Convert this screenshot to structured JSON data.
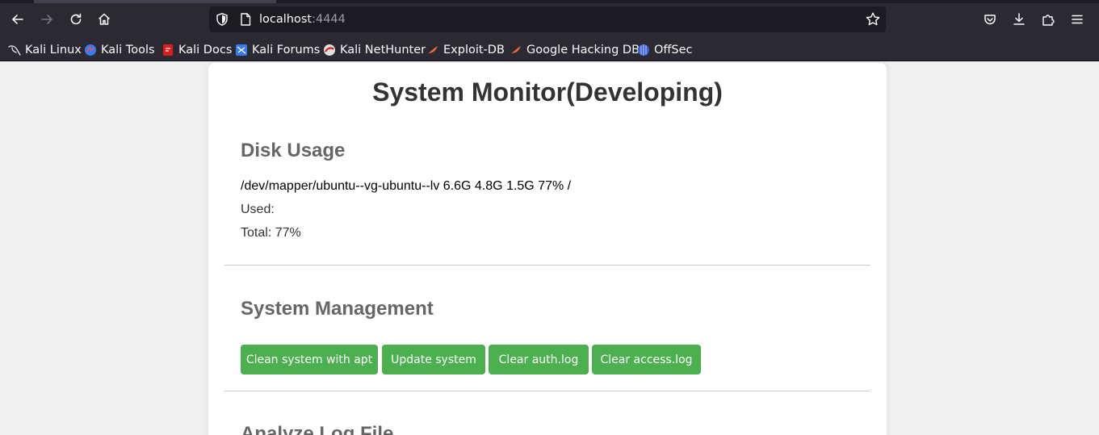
{
  "browser": {
    "url_host": "localhost",
    "url_port": ":4444",
    "bookmarks": [
      {
        "label": "Kali Linux",
        "icon": "kali-dragon-icon"
      },
      {
        "label": "Kali Tools",
        "icon": "kali-tools-icon"
      },
      {
        "label": "Kali Docs",
        "icon": "kali-docs-icon"
      },
      {
        "label": "Kali Forums",
        "icon": "kali-forums-icon"
      },
      {
        "label": "Kali NetHunter",
        "icon": "nethunter-icon"
      },
      {
        "label": "Exploit-DB",
        "icon": "exploit-db-icon"
      },
      {
        "label": "Google Hacking DB",
        "icon": "ghdb-icon"
      },
      {
        "label": "OffSec",
        "icon": "offsec-icon"
      }
    ]
  },
  "page": {
    "title": "System Monitor(Developing)",
    "disk": {
      "heading": "Disk Usage",
      "df_line": "/dev/mapper/ubuntu--vg-ubuntu--lv 6.6G 4.8G 1.5G 77% /",
      "used": "Used:",
      "total": "Total: 77%"
    },
    "management": {
      "heading": "System Management",
      "buttons": [
        "Clean system with apt",
        "Update system",
        "Clear auth.log",
        "Clear access.log"
      ]
    },
    "analyze": {
      "heading": "Analyze Log File"
    }
  },
  "colors": {
    "accent_button": "#4caf50",
    "toolbar": "#2b2a33",
    "page_bg": "#f0f0f0"
  }
}
